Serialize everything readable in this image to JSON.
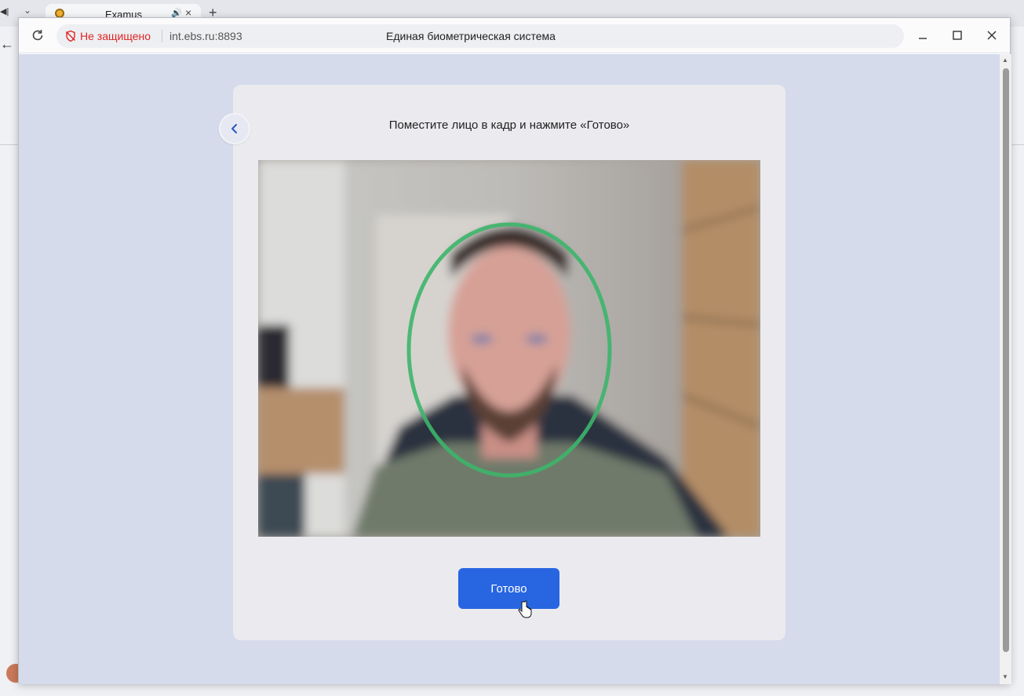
{
  "background_browser": {
    "tab_title": "Examus"
  },
  "window": {
    "security_status": "Не защищено",
    "host": "int.ebs.ru:8893",
    "title": "Единая биометрическая система"
  },
  "page": {
    "instruction": "Поместите лицо в кадр и нажмите «Готово»",
    "done_button": "Готово"
  },
  "colors": {
    "accent": "#2765e1",
    "face_oval": "#3cb56a",
    "warning": "#e02424",
    "page_bg": "#d5dbeb",
    "card_bg": "#ebebef"
  },
  "icons": [
    "reload-icon",
    "shield-off-icon",
    "minimize-icon",
    "maximize-icon",
    "close-icon",
    "chevron-left-icon",
    "cursor-icon"
  ]
}
